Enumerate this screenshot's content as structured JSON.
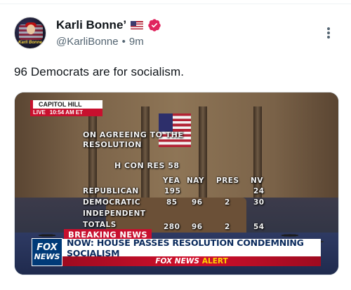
{
  "author": {
    "display_name": "Karli Bonne’",
    "handle": "@KarliBonne",
    "separator": "•",
    "age": "9m",
    "avatar_caption": "Karli Bonne"
  },
  "post": {
    "text": "96 Democrats are for socialism."
  },
  "media": {
    "location_bug": {
      "title": "CAPITOL HILL",
      "live": "LIVE",
      "time": "10:54 AM ET"
    },
    "vote_title": "ON AGREEING TO THE RESOLUTION",
    "resolution": "H CON RES 58",
    "headers": [
      "YEA",
      "NAY",
      "PRES",
      "NV"
    ],
    "rows": [
      {
        "party": "REPUBLICAN",
        "yea": "195",
        "nay": "",
        "pres": "",
        "nv": "24"
      },
      {
        "party": "DEMOCRATIC",
        "yea": "85",
        "nay": "96",
        "pres": "2",
        "nv": "30"
      },
      {
        "party": "INDEPENDENT",
        "yea": "",
        "nay": "",
        "pres": "",
        "nv": ""
      },
      {
        "party": "TOTALS",
        "yea": "280",
        "nay": "96",
        "pres": "2",
        "nv": "54"
      }
    ],
    "breaking_label": "BREAKING NEWS",
    "network_logo": {
      "line1": "FOX",
      "line2": "NEWS"
    },
    "headline": "NOW: HOUSE PASSES RESOLUTION CONDEMNING SOCIALISM",
    "alert_brand": "FOX NEWS",
    "alert_word": "ALERT"
  },
  "icons": {
    "flag": "us-flag-icon",
    "verified": "verified-badge-icon",
    "more": "more-options-icon"
  },
  "colors": {
    "verified_badge": "#e0245e",
    "fox_red": "#c8102e",
    "fox_blue": "#003a78"
  }
}
